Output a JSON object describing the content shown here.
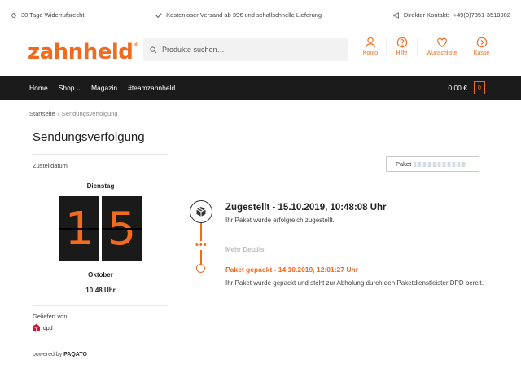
{
  "topbar": {
    "returns": "30 Tage Widerrufsrecht",
    "shipping": "Kostenloser Versand ab 39€ und schallschnelle Lieferung",
    "contact_label": "Direkter  Kontakt:",
    "contact_phone": "+49(0)7351-3518902"
  },
  "header": {
    "logo": "zahnheld",
    "logo_mark": "®",
    "search_placeholder": "Produkte suchen…",
    "icons": [
      {
        "label": "Konto",
        "icon": "user-icon"
      },
      {
        "label": "Hilfe",
        "icon": "help-icon"
      },
      {
        "label": "Wunschliste",
        "icon": "heart-icon"
      },
      {
        "label": "Kasse",
        "icon": "arrow-circle-icon"
      }
    ]
  },
  "nav": {
    "items": [
      "Home",
      "Shop",
      "Magazin",
      "#teamzahnheld"
    ],
    "cart_total": "0,00 €",
    "cart_count": "0"
  },
  "breadcrumb": {
    "home": "Startseite",
    "current": "Sendungsverfolgung"
  },
  "tracking": {
    "title": "Sendungsverfolgung",
    "delivery_label": "Zustelldatum",
    "weekday": "Dienstag",
    "day_digits": [
      "1",
      "5"
    ],
    "month": "Oktober",
    "time": "10:48 Uhr",
    "delivered_by_label": "Geliefert von",
    "carrier": "dpd",
    "powered_prefix": "powered by",
    "powered_brand": "PAQATO",
    "package_label": "Paket"
  },
  "events": [
    {
      "title": "Zugestellt - 15.10.2019, 10:48:08 Uhr",
      "description": "Ihr Paket wurde erfolgreich zugestellt."
    },
    {
      "title": "Paket gepackt - 14.10.2019, 12:01:27 Uhr",
      "description": "Ihr Paket wurde gepackt und steht zur Abholung durch den Paketdienstleister DPD bereit."
    }
  ],
  "more_details": "Mehr Details",
  "colors": {
    "accent": "#f06a1f",
    "nav_bg": "#1b1b1b",
    "flip_bg": "#1a1a1a",
    "dpd_red": "#d0122c"
  }
}
